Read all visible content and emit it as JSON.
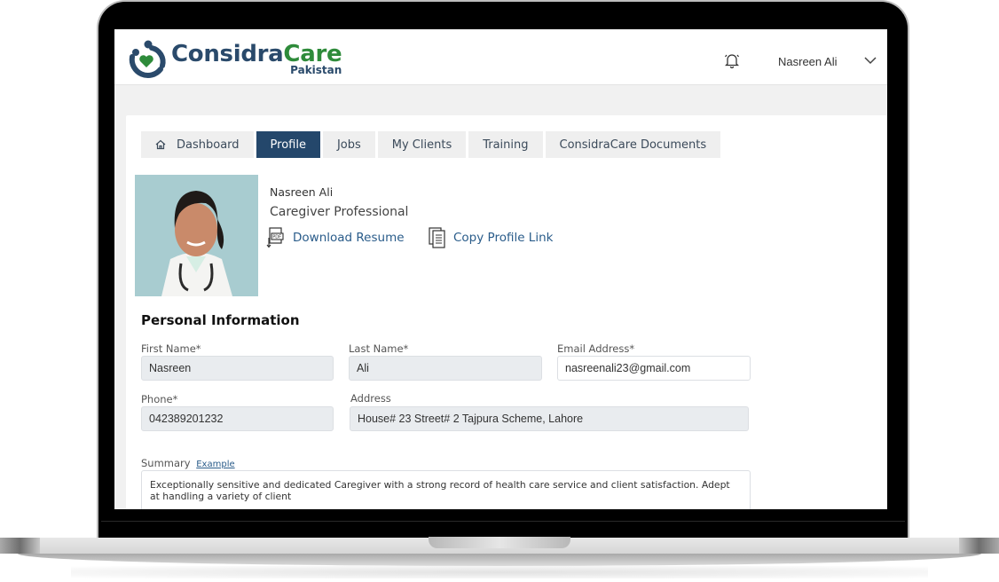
{
  "app": {
    "brand_primary": "Considra",
    "brand_accent": "Care",
    "brand_region": "Pakistan",
    "colors": {
      "brand_navy": "#2a4a6b",
      "brand_green": "#2e8b3a",
      "active_tab": "#24476b",
      "link": "#2a5c8a"
    }
  },
  "header": {
    "notification_icon": "bell-icon",
    "user_name": "Nasreen Ali",
    "user_menu_icon": "chevron-down-icon"
  },
  "tabs": [
    {
      "label": "Dashboard",
      "icon": "home-icon",
      "active": false
    },
    {
      "label": "Profile",
      "active": true
    },
    {
      "label": "Jobs",
      "active": false
    },
    {
      "label": "My Clients",
      "active": false
    },
    {
      "label": "Training",
      "active": false
    },
    {
      "label": "ConsidraCare Documents",
      "active": false
    }
  ],
  "profile": {
    "name": "Nasreen Ali",
    "title": "Caregiver Professional",
    "download_resume_label": "Download Resume",
    "copy_link_label": "Copy Profile Link"
  },
  "personal_info": {
    "section_title": "Personal Information",
    "first_name": {
      "label": "First Name*",
      "value": "Nasreen"
    },
    "last_name": {
      "label": "Last Name*",
      "value": "Ali"
    },
    "email": {
      "label": "Email Address*",
      "value": "nasreenali23@gmail.com"
    },
    "phone": {
      "label": "Phone*",
      "value": "042389201232"
    },
    "address": {
      "label": "Address",
      "value": "House# 23 Street# 2 Tajpura Scheme, Lahore"
    },
    "summary": {
      "label": "Summary",
      "example_link": "Example",
      "value": "Exceptionally sensitive and dedicated Caregiver with a strong record of health care service and client satisfaction. Adept at handling a variety of client"
    }
  }
}
